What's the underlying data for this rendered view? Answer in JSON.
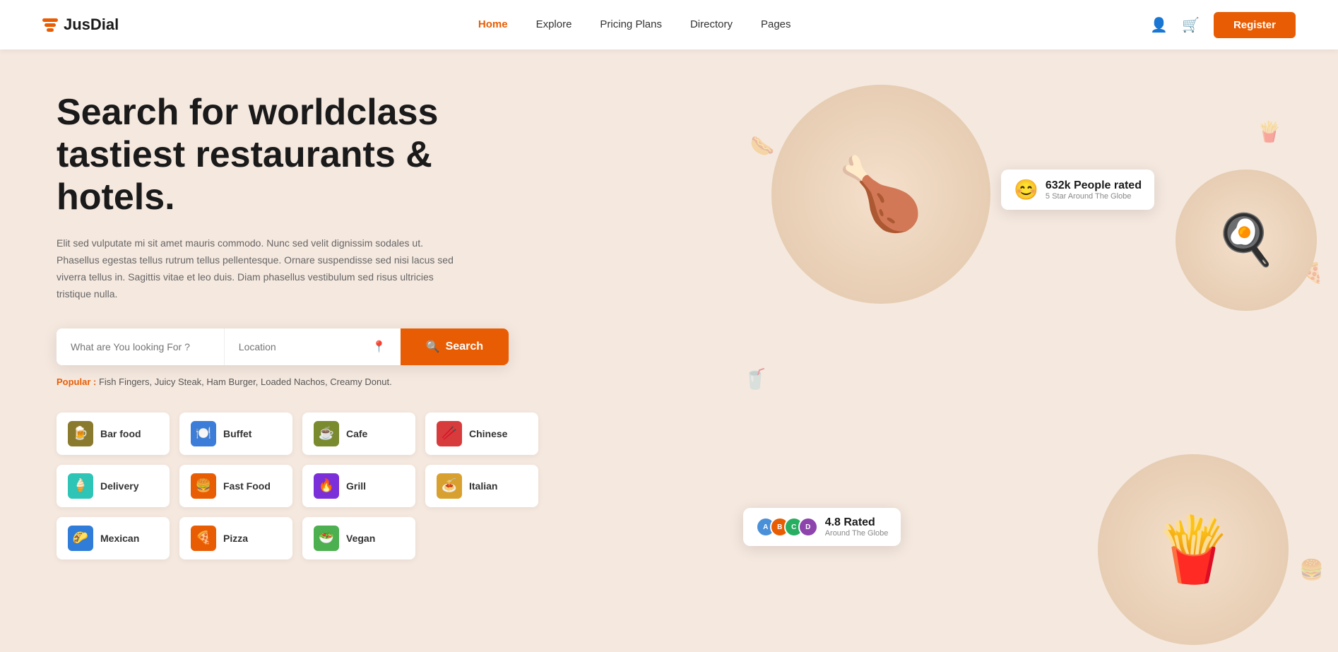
{
  "navbar": {
    "logo_text": "JusDial",
    "links": [
      {
        "label": "Home",
        "active": true
      },
      {
        "label": "Explore",
        "active": false
      },
      {
        "label": "Pricing Plans",
        "active": false
      },
      {
        "label": "Directory",
        "active": false
      },
      {
        "label": "Pages",
        "active": false
      }
    ],
    "register_label": "Register"
  },
  "hero": {
    "title": "Search for worldclass tastiest restaurants & hotels.",
    "description": "Elit sed vulputate mi sit amet mauris commodo. Nunc sed velit dignissim sodales ut. Phasellus egestas tellus rutrum tellus pellentesque. Ornare suspendisse sed nisi lacus sed viverra tellus in. Sagittis vitae et leo duis. Diam phasellus vestibulum sed risus ultricies tristique nulla.",
    "search": {
      "what_placeholder": "What are You looking For ?",
      "location_placeholder": "Location",
      "button_label": "Search"
    },
    "popular": {
      "label": "Popular :",
      "items": "Fish Fingers, Juicy Steak, Ham Burger, Loaded Nachos, Creamy Donut."
    },
    "categories": [
      {
        "label": "Bar food",
        "icon": "🍺",
        "color": "#8a7a2e"
      },
      {
        "label": "Buffet",
        "icon": "🍽️",
        "color": "#3b7dd8"
      },
      {
        "label": "Cafe",
        "icon": "☕",
        "color": "#7a8a2e"
      },
      {
        "label": "Chinese",
        "icon": "🥢",
        "color": "#d83b3b"
      },
      {
        "label": "Delivery",
        "icon": "🍦",
        "color": "#2ec4b6"
      },
      {
        "label": "Fast Food",
        "icon": "🍔",
        "color": "#e85d04"
      },
      {
        "label": "Grill",
        "icon": "🔥",
        "color": "#7b2fd8"
      },
      {
        "label": "Italian",
        "icon": "🍝",
        "color": "#d8a12f"
      },
      {
        "label": "Mexican",
        "icon": "🌮",
        "color": "#2f7dd8"
      },
      {
        "label": "Pizza",
        "icon": "🍕",
        "color": "#e85d04"
      },
      {
        "label": "Vegan",
        "icon": "🥗",
        "color": "#4caf50"
      }
    ],
    "rating_badge_top": {
      "emoji": "😊",
      "main": "632k People rated",
      "sub": "5 Star Around The Globe"
    },
    "rating_badge_bottom": {
      "main": "4.8 Rated",
      "sub": "Around The Globe"
    }
  }
}
